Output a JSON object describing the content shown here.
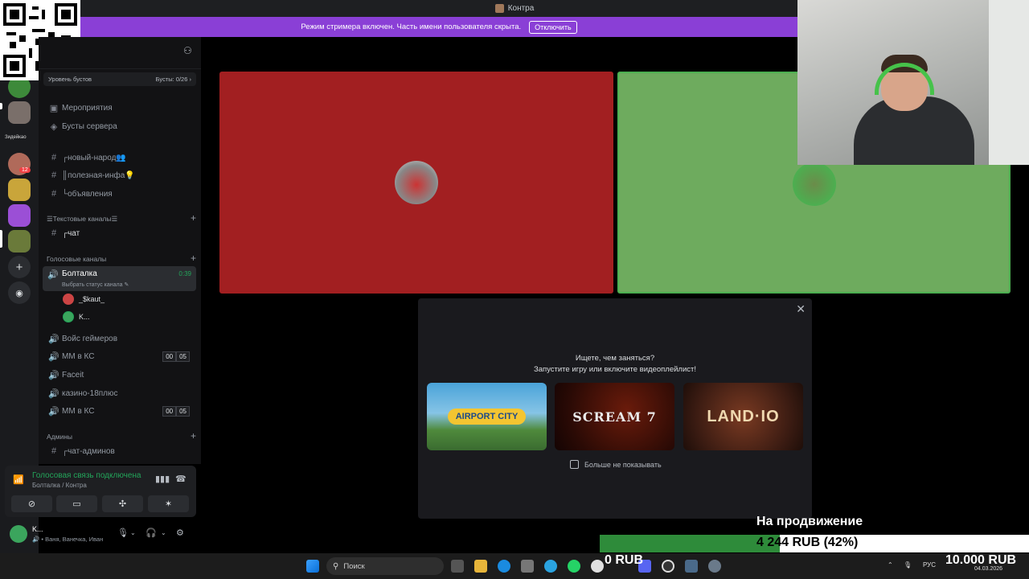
{
  "window": {
    "title": "Контра"
  },
  "banner": {
    "text": "Режим стримера включен. Часть имени пользователя скрыта.",
    "button": "Отключить"
  },
  "rail": {
    "label_text": "Зидейкао",
    "badge": "12"
  },
  "sidebar": {
    "boost_left": "Уровень бустов",
    "boost_right": "Бусты: 0/26 ›",
    "items": [
      {
        "label": "Мероприятия",
        "icon": "calendar-icon"
      },
      {
        "label": "Бусты сервера",
        "icon": "boost-icon"
      }
    ],
    "channels_top": [
      "┌новый-народ👥",
      "║полезная-инфа💡",
      "└объявления"
    ],
    "text_category": "☰Текстовые каналы☰",
    "text_channels": [
      "┌чат"
    ],
    "voice_category": "Голосовые каналы",
    "active_voice": {
      "name": "Болталка",
      "status": "Выбрать статус канала ✎",
      "time": "0:39"
    },
    "voice_users": [
      "_$kaut_",
      "K..."
    ],
    "voice_channels": [
      {
        "name": "Войс геймеров",
        "counter": null
      },
      {
        "name": "ММ в КС",
        "counter": [
          "00",
          "05"
        ]
      },
      {
        "name": "Faceit",
        "counter": null
      },
      {
        "name": "казино-18плюс",
        "counter": null
      },
      {
        "name": "ММ в КС",
        "counter": [
          "00",
          "05"
        ]
      }
    ],
    "admin_category": "Админы",
    "admin_channels": [
      "┌чат-админов"
    ]
  },
  "voice_panel": {
    "connected": "Голосовая связь подключена",
    "path": "Болталка / Контра"
  },
  "user": {
    "name": "K...",
    "status": "🔊 • Ваня, Ванечка, Иван"
  },
  "popup": {
    "line1": "Ищете, чем заняться?",
    "line2": "Запустите игру или включите видеоплейлист!",
    "cards": [
      "AIRPORT CITY",
      "SCREAM 7",
      "LAND·IO"
    ],
    "dont_show": "Больше не показывать"
  },
  "donation": {
    "title": "На продвижение",
    "progress_text": "4 244 RUB (42%)",
    "progress_fraction": 0.42,
    "left_amount": "0 RUB",
    "goal_amount": "10.000 RUB"
  },
  "taskbar": {
    "search_placeholder": "Поиск",
    "lang": "РУС",
    "date": "04.03.2026"
  },
  "colors": {
    "banner": "#8a3fd6",
    "tile_red": "#a21f21",
    "tile_green": "#6eab5e",
    "connected_green": "#23a55a",
    "donation_fill": "#2e8b3a"
  }
}
